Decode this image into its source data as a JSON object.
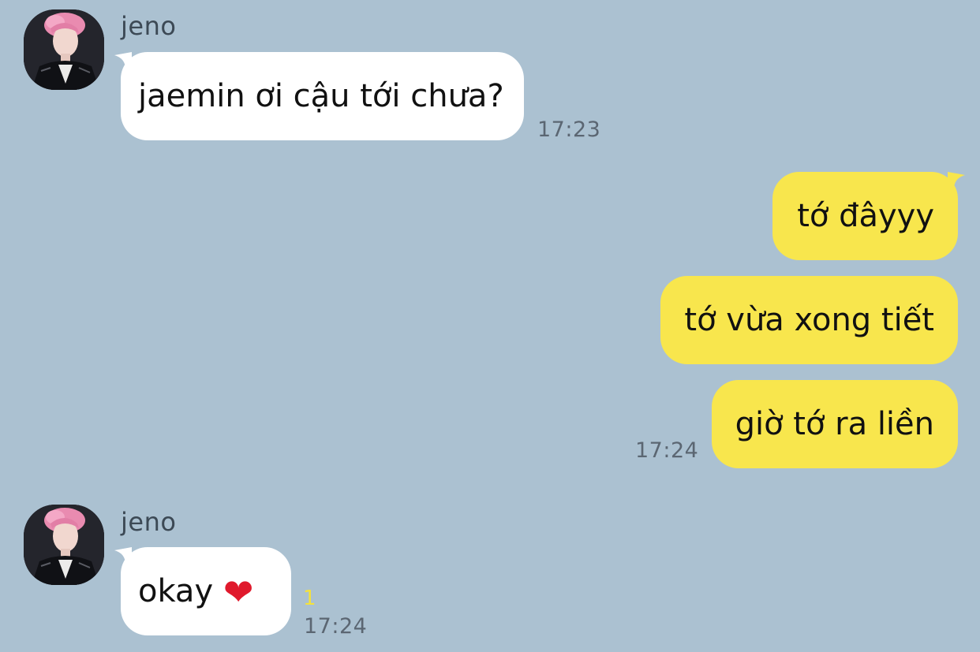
{
  "messages": [
    {
      "sender": "jeno",
      "text": "jaemin ơi cậu tới chưa?",
      "time": "17:23"
    },
    {
      "text": "tớ đâyyy"
    },
    {
      "text": "tớ vừa xong tiết"
    },
    {
      "text": "giờ tớ ra liền",
      "time": "17:24"
    },
    {
      "sender": "jeno",
      "text": "okay",
      "emoji": "❤",
      "time": "17:24",
      "unread": "1"
    }
  ],
  "colors": {
    "background": "#abc1d1",
    "incoming_bubble": "#ffffff",
    "outgoing_bubble": "#f8e64d",
    "unread_count": "#f4e23c"
  },
  "icons": {
    "avatar": "profile-photo",
    "reaction": "red-heart"
  }
}
